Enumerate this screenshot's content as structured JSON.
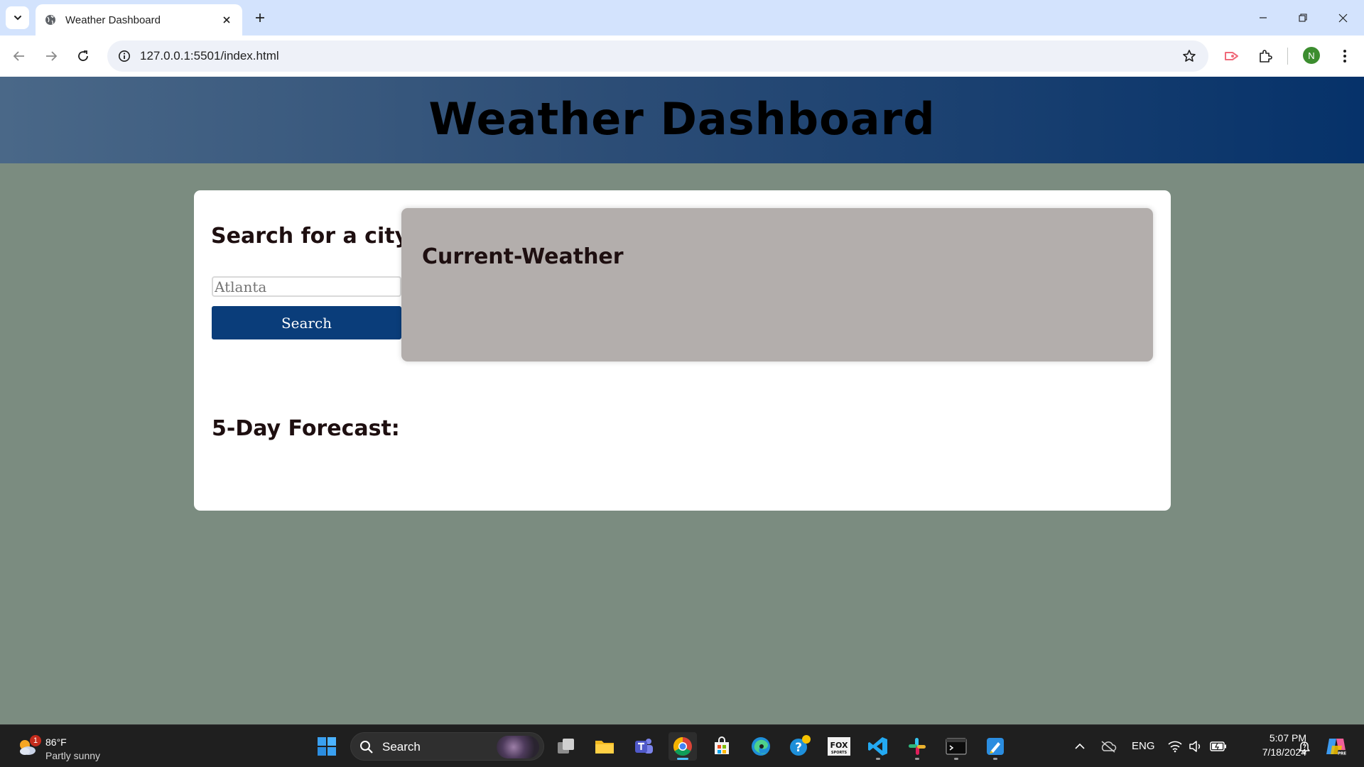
{
  "browser": {
    "tab_title": "Weather Dashboard",
    "url": "127.0.0.1:5501/index.html",
    "profile_initial": "N"
  },
  "page": {
    "title": "Weather Dashboard",
    "search_heading": "Search for a city:",
    "city_input_placeholder": "Atlanta",
    "search_button": "Search",
    "current_weather_heading": "Current-Weather",
    "forecast_heading": "5-Day Forecast:"
  },
  "taskbar": {
    "weather_temp": "86°F",
    "weather_condition": "Partly sunny",
    "weather_badge": "1",
    "search_label": "Search",
    "language": "ENG",
    "time": "5:07 PM",
    "date": "7/18/2024"
  },
  "colors": {
    "page_background": "#7b8c80",
    "header_gradient_start": "#4a6888",
    "header_gradient_end": "#06326a",
    "search_button": "#0a3d7a",
    "current_weather_panel": "#b3aeac"
  }
}
